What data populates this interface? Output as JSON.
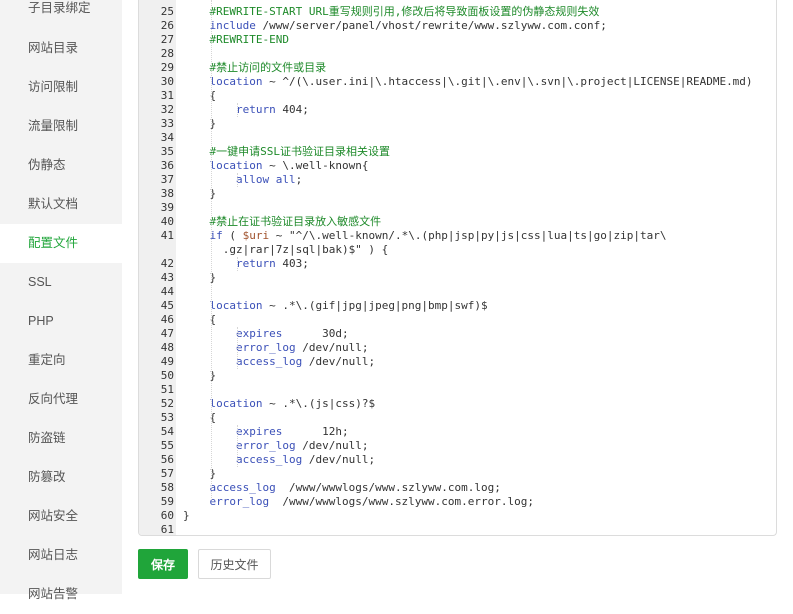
{
  "sidebar": {
    "items": [
      {
        "label": "子目录绑定"
      },
      {
        "label": "网站目录"
      },
      {
        "label": "访问限制"
      },
      {
        "label": "流量限制"
      },
      {
        "label": "伪静态"
      },
      {
        "label": "默认文档"
      },
      {
        "label": "配置文件"
      },
      {
        "label": "SSL"
      },
      {
        "label": "PHP"
      },
      {
        "label": "重定向"
      },
      {
        "label": "反向代理"
      },
      {
        "label": "防盗链"
      },
      {
        "label": "防篡改"
      },
      {
        "label": "网站安全"
      },
      {
        "label": "网站日志"
      },
      {
        "label": "网站告警"
      }
    ],
    "active_label": "配置文件"
  },
  "editor": {
    "colors": {
      "comment": "#1e8a2a",
      "keyword": "#3b50b8",
      "variable": "#a0522d",
      "text": "#333333",
      "gutter_bg": "#f0f0f0"
    },
    "lines": [
      {
        "num": "25",
        "text": "    #REWRITE-START URL重写规则引用,修改后将导致面板设置的伪静态规则失效"
      },
      {
        "num": "26",
        "text": "    include /www/server/panel/vhost/rewrite/www.szlyww.com.conf;"
      },
      {
        "num": "27",
        "text": "    #REWRITE-END"
      },
      {
        "num": "28",
        "text": ""
      },
      {
        "num": "29",
        "text": "    #禁止访问的文件或目录"
      },
      {
        "num": "30",
        "text": "    location ~ ^/(\\.user.ini|\\.htaccess|\\.git|\\.env|\\.svn|\\.project|LICENSE|README.md)"
      },
      {
        "num": "31",
        "text": "    {"
      },
      {
        "num": "32",
        "text": "        return 404;"
      },
      {
        "num": "33",
        "text": "    }"
      },
      {
        "num": "34",
        "text": ""
      },
      {
        "num": "35",
        "text": "    #一键申请SSL证书验证目录相关设置"
      },
      {
        "num": "36",
        "text": "    location ~ \\.well-known{"
      },
      {
        "num": "37",
        "text": "        allow all;"
      },
      {
        "num": "38",
        "text": "    }"
      },
      {
        "num": "39",
        "text": ""
      },
      {
        "num": "40",
        "text": "    #禁止在证书验证目录放入敏感文件"
      },
      {
        "num": "41",
        "text": "    if ( $uri ~ \"^/\\.well-known/.*\\.(php|jsp|py|js|css|lua|ts|go|zip|tar\\"
      },
      {
        "num": "",
        "text": "      .gz|rar|7z|sql|bak)$\" ) {"
      },
      {
        "num": "42",
        "text": "        return 403;"
      },
      {
        "num": "43",
        "text": "    }"
      },
      {
        "num": "44",
        "text": ""
      },
      {
        "num": "45",
        "text": "    location ~ .*\\.(gif|jpg|jpeg|png|bmp|swf)$"
      },
      {
        "num": "46",
        "text": "    {"
      },
      {
        "num": "47",
        "text": "        expires      30d;"
      },
      {
        "num": "48",
        "text": "        error_log /dev/null;"
      },
      {
        "num": "49",
        "text": "        access_log /dev/null;"
      },
      {
        "num": "50",
        "text": "    }"
      },
      {
        "num": "51",
        "text": ""
      },
      {
        "num": "52",
        "text": "    location ~ .*\\.(js|css)?$"
      },
      {
        "num": "53",
        "text": "    {"
      },
      {
        "num": "54",
        "text": "        expires      12h;"
      },
      {
        "num": "55",
        "text": "        error_log /dev/null;"
      },
      {
        "num": "56",
        "text": "        access_log /dev/null;"
      },
      {
        "num": "57",
        "text": "    }"
      },
      {
        "num": "58",
        "text": "    access_log  /www/wwwlogs/www.szlyww.com.log;"
      },
      {
        "num": "59",
        "text": "    error_log  /www/wwwlogs/www.szlyww.com.error.log;"
      },
      {
        "num": "60",
        "text": "}"
      },
      {
        "num": "61",
        "text": ""
      }
    ]
  },
  "actions": {
    "save_label": "保存",
    "history_label": "历史文件"
  }
}
